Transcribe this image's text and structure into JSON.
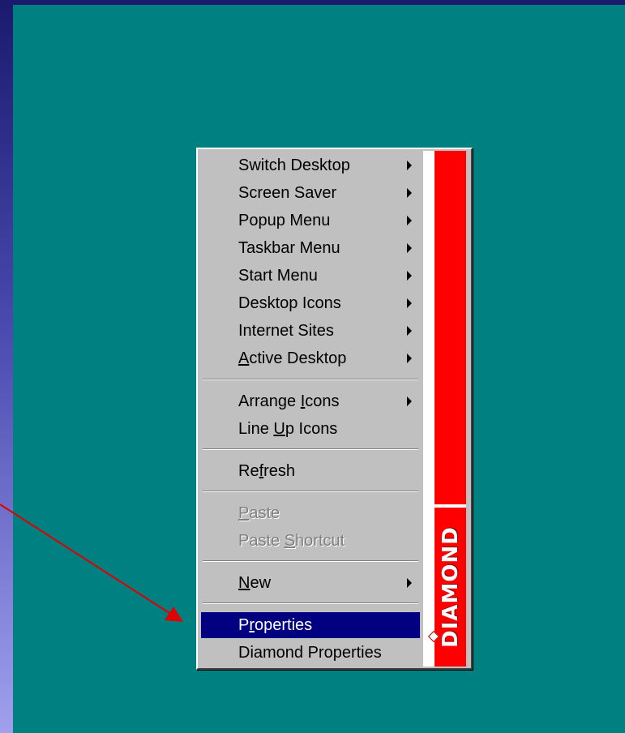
{
  "menu": {
    "items": [
      {
        "label": "Switch Desktop",
        "submenu": true
      },
      {
        "label": "Screen Saver",
        "submenu": true
      },
      {
        "label": "Popup Menu",
        "submenu": true
      },
      {
        "label": "Taskbar Menu",
        "submenu": true
      },
      {
        "label": "Start Menu",
        "submenu": true
      },
      {
        "label": "Desktop Icons",
        "submenu": true
      },
      {
        "label": "Internet Sites",
        "submenu": true
      },
      {
        "label_pre": "",
        "label_u": "A",
        "label_post": "ctive Desktop",
        "submenu": true
      },
      {
        "label_pre": "Arrange ",
        "label_u": "I",
        "label_post": "cons",
        "submenu": true
      },
      {
        "label_pre": "Line ",
        "label_u": "U",
        "label_post": "p Icons"
      },
      {
        "label_pre": "Re",
        "label_u": "f",
        "label_post": "resh"
      },
      {
        "label_pre": "",
        "label_u": "P",
        "label_post": "aste",
        "disabled": true
      },
      {
        "label_pre": "Paste ",
        "label_u": "S",
        "label_post": "hortcut",
        "disabled": true
      },
      {
        "label_pre": "",
        "label_u": "N",
        "label_post": "ew",
        "submenu": true
      },
      {
        "label_pre": "P",
        "label_u": "r",
        "label_post": "operties",
        "selected": true
      },
      {
        "label": "Diamond Properties"
      }
    ]
  },
  "sidebar": {
    "brand": "DIAMOND",
    "accent_color": "#ff0000"
  },
  "colors": {
    "desktop": "#008080",
    "menu_face": "#c0c0c0",
    "highlight": "#000080",
    "arrow": "#e00000"
  },
  "annotation": {
    "type": "arrow",
    "points_to": "Properties"
  }
}
